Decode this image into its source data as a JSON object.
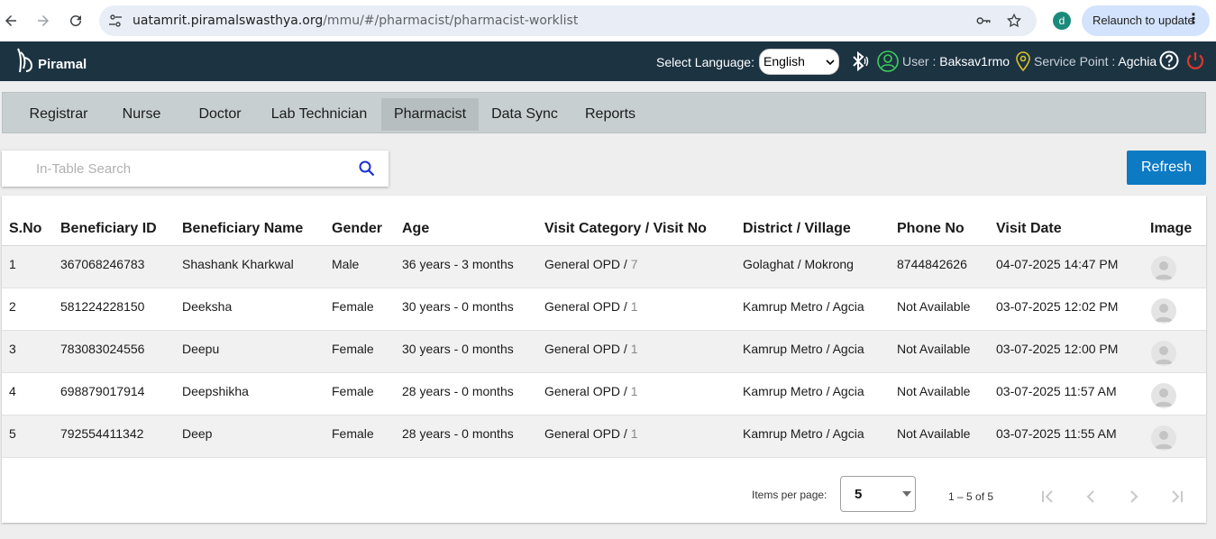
{
  "browser": {
    "url_host": "uatamrit.piramalswasthya.org",
    "url_path": "/mmu/#/pharmacist/pharmacist-worklist",
    "profile_initial": "d",
    "relaunch_label": "Relaunch to update"
  },
  "header": {
    "brand": "Piramal",
    "language_label": "Select Language:",
    "language_value": "English",
    "user_label": "User :",
    "user_value": "Baksav1rmo",
    "service_label": "Service Point :",
    "service_value": "Agchia"
  },
  "tabs": [
    {
      "label": "Registrar"
    },
    {
      "label": "Nurse"
    },
    {
      "label": "Doctor"
    },
    {
      "label": "Lab Technician"
    },
    {
      "label": "Pharmacist"
    },
    {
      "label": "Data Sync"
    },
    {
      "label": "Reports"
    }
  ],
  "search": {
    "placeholder": "In-Table Search"
  },
  "refresh_label": "Refresh",
  "table": {
    "headers": [
      "S.No",
      "Beneficiary ID",
      "Beneficiary Name",
      "Gender",
      "Age",
      "Visit Category / Visit No",
      "District / Village",
      "Phone No",
      "Visit Date",
      "Image"
    ],
    "rows": [
      {
        "sno": "1",
        "id": "367068246783",
        "name": "Shashank Kharkwal",
        "gender": "Male",
        "age": "36 years - 3 months",
        "category": "General OPD / ",
        "visit_no": "7",
        "district": "Golaghat / Mokrong",
        "phone": "8744842626",
        "date": "04-07-2025 14:47 PM"
      },
      {
        "sno": "2",
        "id": "581224228150",
        "name": "Deeksha",
        "gender": "Female",
        "age": "30 years - 0 months",
        "category": "General OPD / ",
        "visit_no": "1",
        "district": "Kamrup Metro / Agcia",
        "phone": "Not Available",
        "date": "03-07-2025 12:02 PM"
      },
      {
        "sno": "3",
        "id": "783083024556",
        "name": "Deepu",
        "gender": "Female",
        "age": "30 years - 0 months",
        "category": "General OPD / ",
        "visit_no": "1",
        "district": "Kamrup Metro / Agcia",
        "phone": "Not Available",
        "date": "03-07-2025 12:00 PM"
      },
      {
        "sno": "4",
        "id": "698879017914",
        "name": "Deepshikha",
        "gender": "Female",
        "age": "28 years - 0 months",
        "category": "General OPD / ",
        "visit_no": "1",
        "district": "Kamrup Metro / Agcia",
        "phone": "Not Available",
        "date": "03-07-2025 11:57 AM"
      },
      {
        "sno": "5",
        "id": "792554411342",
        "name": "Deep",
        "gender": "Female",
        "age": "28 years - 0 months",
        "category": "General OPD / ",
        "visit_no": "1",
        "district": "Kamrup Metro / Agcia",
        "phone": "Not Available",
        "date": "03-07-2025 11:55 AM"
      }
    ]
  },
  "paginator": {
    "items_per_page_label": "Items per page:",
    "page_size": "5",
    "range_label": "1 – 5 of 5"
  },
  "colors": {
    "header_bg": "#1c3342",
    "accent": "#0d7ac4",
    "user_icon": "#3ecf5a",
    "service_icon": "#d9c22a",
    "power_icon": "#e0382c"
  }
}
